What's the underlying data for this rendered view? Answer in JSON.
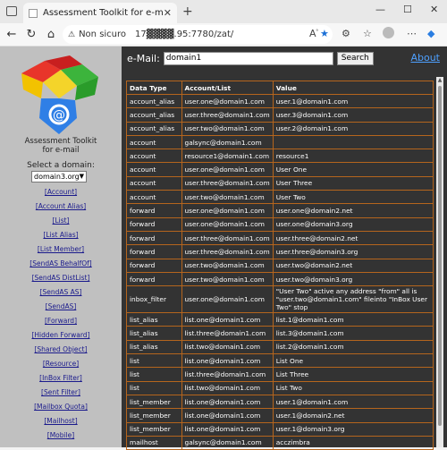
{
  "browser": {
    "tab_title": "Assessment Toolkit for e-mail",
    "security_label": "Non sicuro",
    "url": "17▓▓▓▓.95:7780/zat/"
  },
  "sidebar": {
    "app_title_line1": "Assessment Toolkit",
    "app_title_line2": "for e-mail",
    "select_label": "Select a domain:",
    "selected_domain": "domain3.org",
    "links": [
      "[Account]",
      "[Account Alias]",
      "[List]",
      "[List Alias]",
      "[List Member]",
      "[SendAS BehalfOf]",
      "[SendAS DistList]",
      "[SendAS AS]",
      "[SendAS]",
      "[Forward]",
      "[Hidden Forward]",
      "[Shared Object]",
      "[Resource]",
      "[InBox Filter]",
      "[Sent Filter]",
      "[Mailbox Quota]",
      "[Mailhost]",
      "[Mobile]"
    ]
  },
  "topbar": {
    "email_label": "e-Mail:",
    "email_value": "domain1",
    "search_label": "Search",
    "about_label": "About"
  },
  "table": {
    "headers": [
      "Data Type",
      "Account/List",
      "Value"
    ],
    "rows": [
      [
        "account_alias",
        "user.one@domain1.com",
        "user.1@domain1.com"
      ],
      [
        "account_alias",
        "user.three@domain1.com",
        "user.3@domain1.com"
      ],
      [
        "account_alias",
        "user.two@domain1.com",
        "user.2@domain1.com"
      ],
      [
        "account",
        "galsync@domain1.com",
        ""
      ],
      [
        "account",
        "resource1@domain1.com",
        "resource1"
      ],
      [
        "account",
        "user.one@domain1.com",
        "User One"
      ],
      [
        "account",
        "user.three@domain1.com",
        "User Three"
      ],
      [
        "account",
        "user.two@domain1.com",
        "User Two"
      ],
      [
        "forward",
        "user.one@domain1.com",
        "user.one@domain2.net"
      ],
      [
        "forward",
        "user.one@domain1.com",
        "user.one@domain3.org"
      ],
      [
        "forward",
        "user.three@domain1.com",
        "user.three@domain2.net"
      ],
      [
        "forward",
        "user.three@domain1.com",
        "user.three@domain3.org"
      ],
      [
        "forward",
        "user.two@domain1.com",
        "user.two@domain2.net"
      ],
      [
        "forward",
        "user.two@domain1.com",
        "user.two@domain3.org"
      ],
      [
        "inbox_filter",
        "user.one@domain1.com",
        "\"User Two\" active any address \"from\" all is \"user.two@domain1.com\" fileinto \"InBox User Two\" stop"
      ],
      [
        "list_alias",
        "list.one@domain1.com",
        "list.1@domain1.com"
      ],
      [
        "list_alias",
        "list.three@domain1.com",
        "list.3@domain1.com"
      ],
      [
        "list_alias",
        "list.two@domain1.com",
        "list.2@domain1.com"
      ],
      [
        "list",
        "list.one@domain1.com",
        "List One"
      ],
      [
        "list",
        "list.three@domain1.com",
        "List Three"
      ],
      [
        "list",
        "list.two@domain1.com",
        "List Two"
      ],
      [
        "list_member",
        "list.one@domain1.com",
        "user.1@domain1.com"
      ],
      [
        "list_member",
        "list.one@domain1.com",
        "user.1@domain2.net"
      ],
      [
        "list_member",
        "list.one@domain1.com",
        "user.1@domain3.org"
      ],
      [
        "mailhost",
        "galsync@domain1.com",
        "acczimbra"
      ]
    ]
  },
  "colors": {
    "sidebar_bg": "#c0c0c0",
    "main_bg": "#333333",
    "table_border": "#b5651d",
    "link": "#1a1a8c",
    "about_link": "#4ea0ff"
  }
}
